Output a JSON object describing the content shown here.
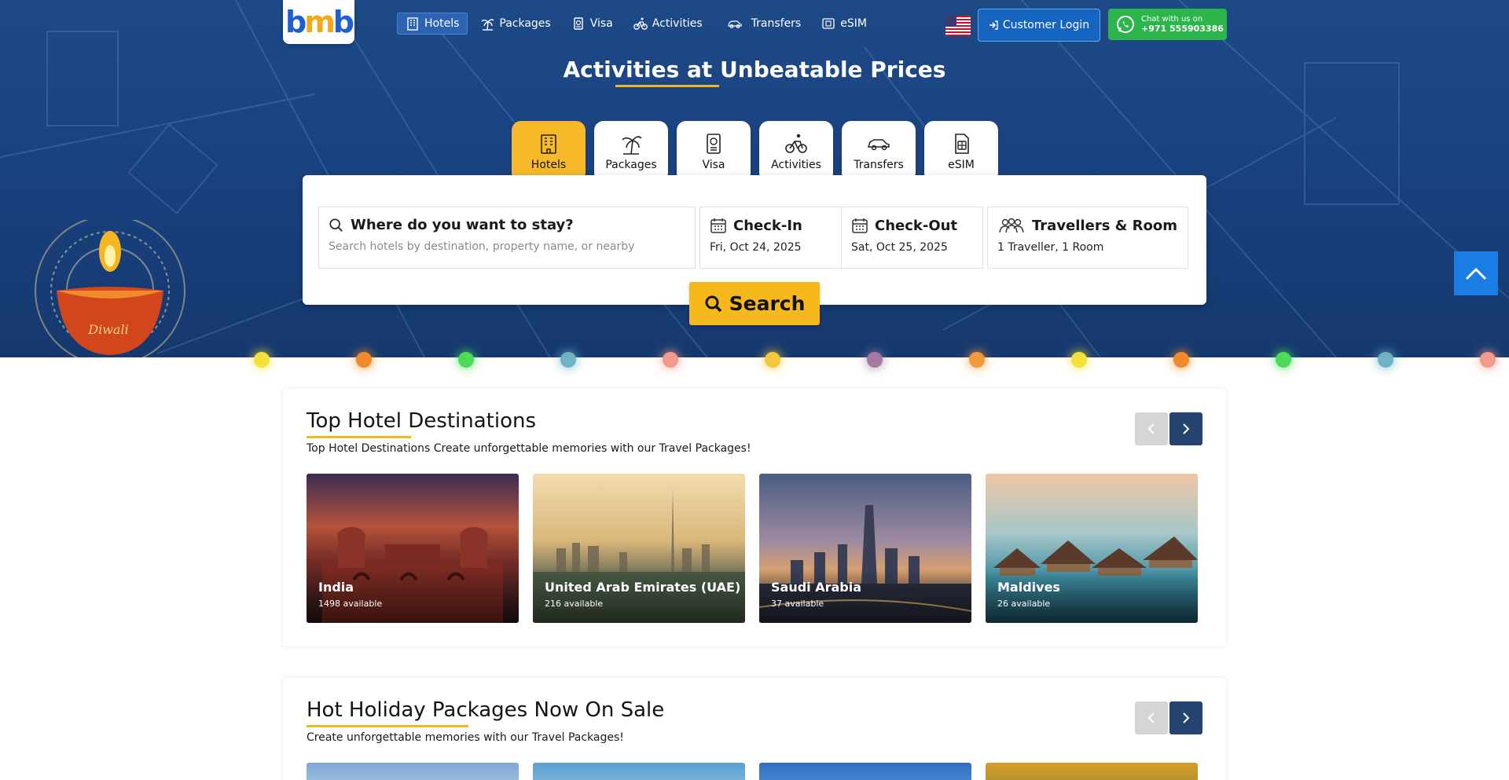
{
  "brand": {
    "logo_text": "bmb",
    "accent": "#f7b92a",
    "primary": "#1565c0",
    "hero_bg": "#1a4280"
  },
  "nav": {
    "items": [
      {
        "label": "Hotels",
        "icon": "hotel-icon",
        "active": true
      },
      {
        "label": "Packages",
        "icon": "palm-tree-icon",
        "active": false
      },
      {
        "label": "Visa",
        "icon": "passport-icon",
        "active": false
      },
      {
        "label": "Activities",
        "icon": "bicycle-icon",
        "active": false
      },
      {
        "label": "Transfers",
        "icon": "car-icon",
        "active": false
      },
      {
        "label": "eSIM",
        "icon": "sim-card-icon",
        "active": false
      }
    ],
    "login_label": "Customer Login",
    "whatsapp": {
      "line1": "Chat with us on",
      "line2": "+971 555903386"
    }
  },
  "hero": {
    "title": "Activities at Unbeatable Prices",
    "decoration_text": "Diwali"
  },
  "tabs": [
    {
      "label": "Hotels",
      "icon": "hotel-icon",
      "active": true
    },
    {
      "label": "Packages",
      "icon": "palm-tree-icon",
      "active": false
    },
    {
      "label": "Visa",
      "icon": "passport-icon",
      "active": false
    },
    {
      "label": "Activities",
      "icon": "bicycle-icon",
      "active": false
    },
    {
      "label": "Transfers",
      "icon": "car-icon",
      "active": false
    },
    {
      "label": "eSIM",
      "icon": "sim-card-icon",
      "active": false
    }
  ],
  "search": {
    "destination_label": "Where do you want to stay?",
    "destination_placeholder": "Search hotels by destination, property name, or nearby",
    "checkin_label": "Check-In",
    "checkin_value": "Fri, Oct 24, 2025",
    "checkout_label": "Check-Out",
    "checkout_value": "Sat, Oct 25, 2025",
    "travellers_label": "Travellers & Room",
    "travellers_value": "1 Traveller, 1 Room",
    "button_label": "Search"
  },
  "destinations": {
    "title": "Top Hotel Destinations",
    "subtitle": "Top Hotel Destinations Create unforgettable memories with our Travel Packages!",
    "cards": [
      {
        "name": "India",
        "count": "1498 available"
      },
      {
        "name": "United Arab Emirates (UAE)",
        "count": "216 available"
      },
      {
        "name": "Saudi Arabia",
        "count": "37 available"
      },
      {
        "name": "Maldives",
        "count": "26 available"
      }
    ]
  },
  "packages": {
    "title": "Hot Holiday Packages Now On Sale",
    "subtitle": "Create unforgettable memories with our Travel Packages!"
  }
}
